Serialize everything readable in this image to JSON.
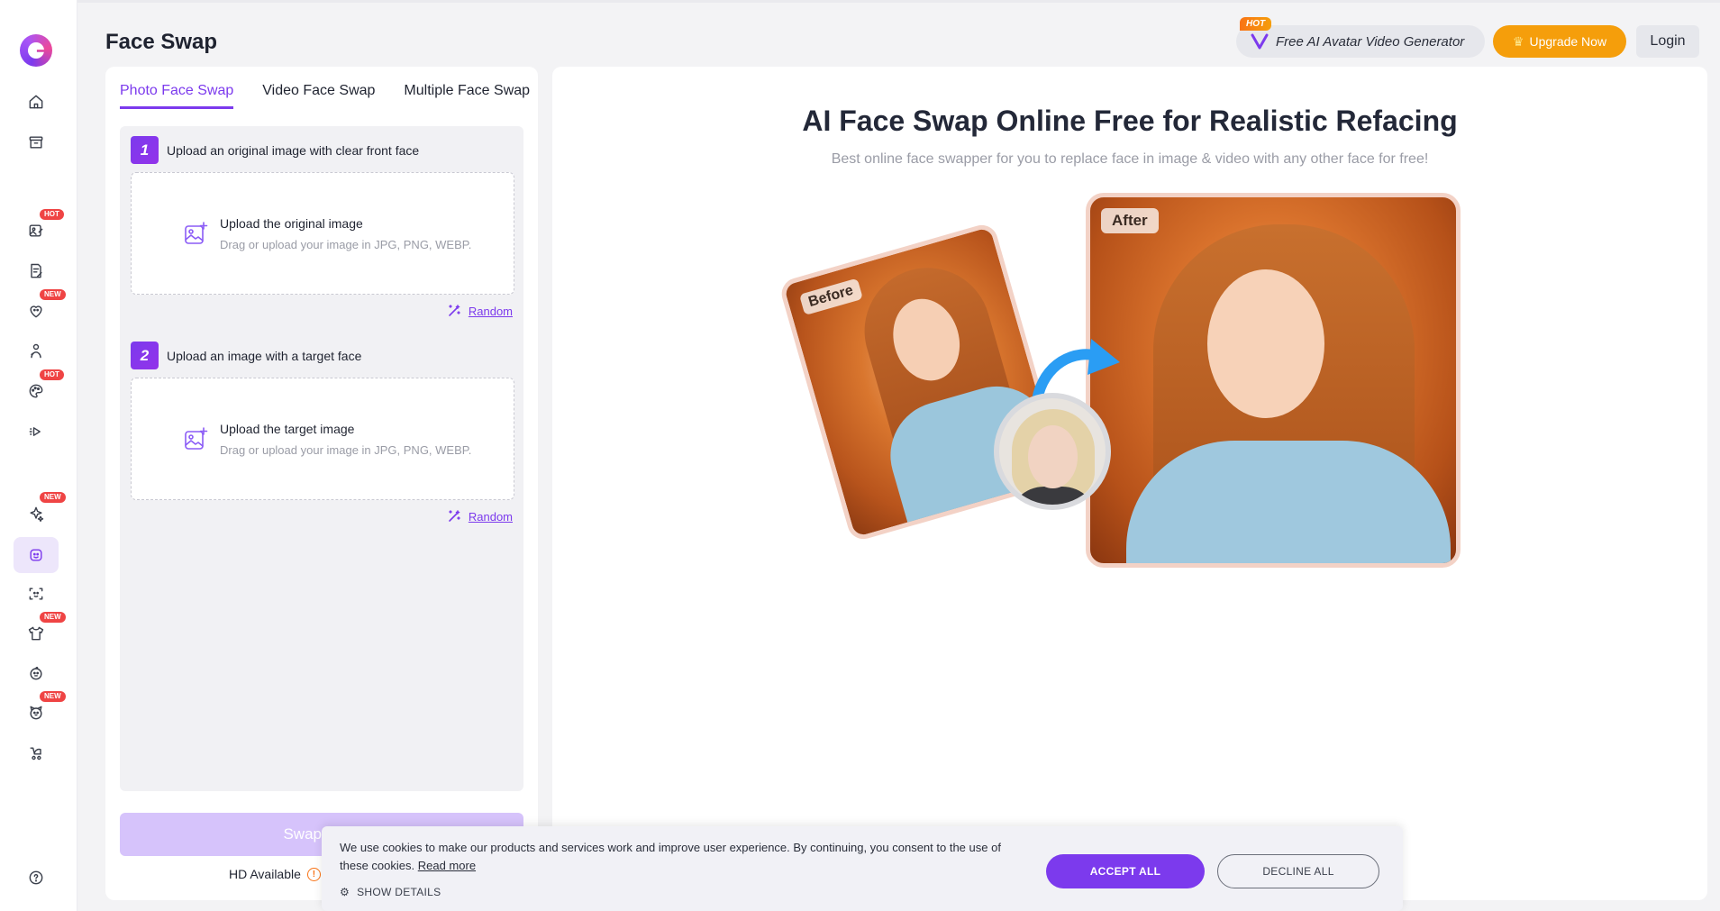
{
  "header": {
    "title": "Face Swap",
    "avatar_generator_label": "Free AI Avatar Video Generator",
    "avatar_generator_tag": "HOT",
    "upgrade_label": "Upgrade Now",
    "login_label": "Login"
  },
  "sidebar": {
    "items": [
      {
        "icon": "home-icon"
      },
      {
        "icon": "archive-icon"
      },
      {
        "icon": "image-edit-icon",
        "badge": "HOT"
      },
      {
        "icon": "document-edit-icon"
      },
      {
        "icon": "heart-face-icon",
        "badge": "NEW"
      },
      {
        "icon": "person-pose-icon"
      },
      {
        "icon": "palette-icon",
        "badge": "HOT"
      },
      {
        "icon": "video-play-icon"
      },
      {
        "icon": "sparkles-icon",
        "badge": "NEW"
      },
      {
        "icon": "face-swap-icon",
        "active": true
      },
      {
        "icon": "face-scan-icon"
      },
      {
        "icon": "tshirt-icon",
        "badge": "NEW"
      },
      {
        "icon": "baby-face-icon"
      },
      {
        "icon": "pet-face-icon",
        "badge": "NEW"
      },
      {
        "icon": "stroller-icon"
      },
      {
        "icon": "help-icon"
      }
    ]
  },
  "tabs": [
    {
      "label": "Photo Face Swap",
      "active": true
    },
    {
      "label": "Video Face Swap"
    },
    {
      "label": "Multiple Face Swap"
    }
  ],
  "steps": [
    {
      "number": "1",
      "title": "Upload an original image with clear front face",
      "upload_title": "Upload the original image",
      "upload_sub": "Drag or upload your image in JPG, PNG, WEBP.",
      "random_label": "Random"
    },
    {
      "number": "2",
      "title": "Upload an image with a target face",
      "upload_title": "Upload the target image",
      "upload_sub": "Drag or upload your image in JPG, PNG, WEBP.",
      "random_label": "Random"
    }
  ],
  "swap_button_label": "Swap Face",
  "hd_label": "HD Available",
  "hero": {
    "title": "AI Face Swap Online Free for Realistic Refacing",
    "subtitle": "Best online face swapper for you to replace face in image & video with any other face for free!",
    "before_label": "Before",
    "after_label": "After"
  },
  "cookie": {
    "text": "We use cookies to make our products and services work and improve user experience. By continuing, you consent to the use of these cookies.",
    "read_more": "Read more",
    "show_details": "SHOW DETAILS",
    "accept": "ACCEPT ALL",
    "decline": "DECLINE ALL"
  },
  "colors": {
    "accent": "#7c3aed",
    "upgrade": "#f59e0b",
    "badge": "#ef4444"
  }
}
